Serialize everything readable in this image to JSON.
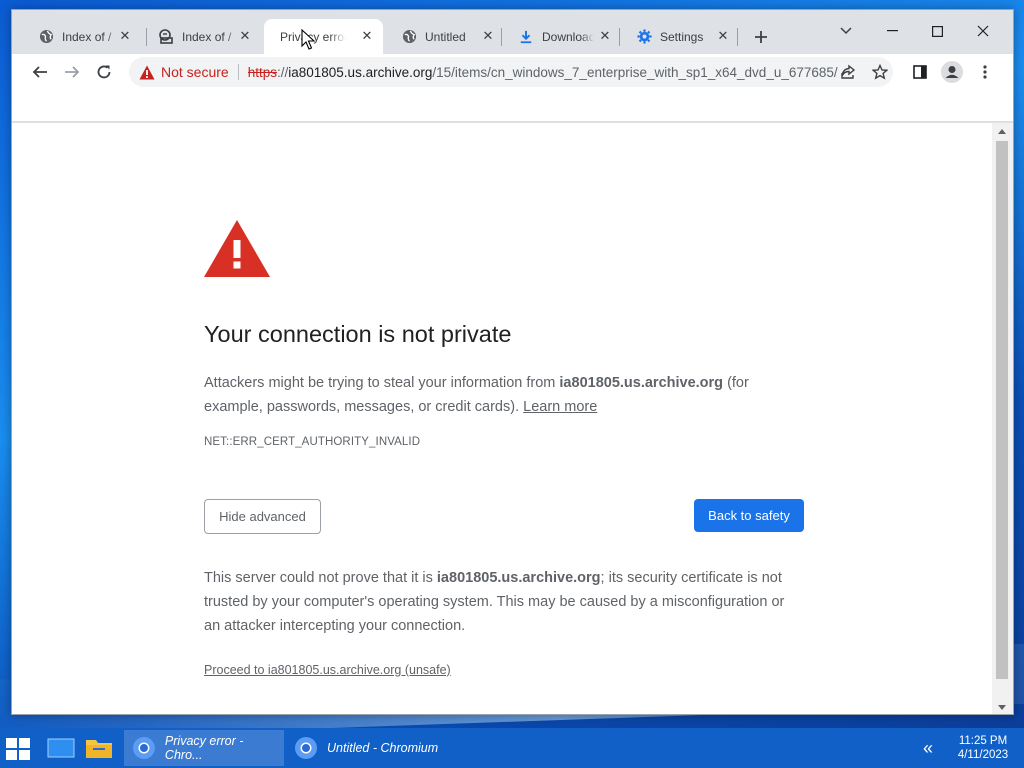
{
  "tabs": [
    {
      "title": "Index of /",
      "icon": "globe-icon",
      "active": false
    },
    {
      "title": "Index of /",
      "icon": "archive-icon",
      "active": false
    },
    {
      "title": "Privacy error",
      "icon": "none",
      "active": true
    },
    {
      "title": "Untitled",
      "icon": "globe-icon",
      "active": false
    },
    {
      "title": "Downloads",
      "icon": "download-icon",
      "active": false
    },
    {
      "title": "Settings",
      "icon": "gear-icon",
      "active": false
    }
  ],
  "omnibox": {
    "security_label": "Not secure",
    "url_scheme": "https",
    "url_sep": "://",
    "url_host": "ia801805.us.archive.org",
    "url_path": "/15/items/cn_windows_7_enterprise_with_sp1_x64_dvd_u_677685/..."
  },
  "interstitial": {
    "heading": "Your connection is not private",
    "explain_prefix": "Attackers might be trying to steal your information from ",
    "host": "ia801805.us.archive.org",
    "explain_suffix": " (for example, passwords, messages, or credit cards). ",
    "learn_more": "Learn more",
    "error_code": "NET::ERR_CERT_AUTHORITY_INVALID",
    "hide_advanced": "Hide advanced",
    "back_to_safety": "Back to safety",
    "details_prefix": "This server could not prove that it is ",
    "details_suffix": "; its security certificate is not trusted by your computer's operating system. This may be caused by a misconfiguration or an attacker intercepting your connection.",
    "proceed_link": "Proceed to ia801805.us.archive.org (unsafe)"
  },
  "taskbar": {
    "tasks": [
      {
        "label": "Privacy error - Chro...",
        "active": true
      },
      {
        "label": "Untitled - Chromium",
        "active": false
      }
    ],
    "time": "11:25 PM",
    "date": "4/11/2023"
  },
  "colors": {
    "accent": "#1a73e8",
    "warning_red": "#d93025",
    "not_secure_red": "#c5221f",
    "taskbar": "#1060c8"
  }
}
